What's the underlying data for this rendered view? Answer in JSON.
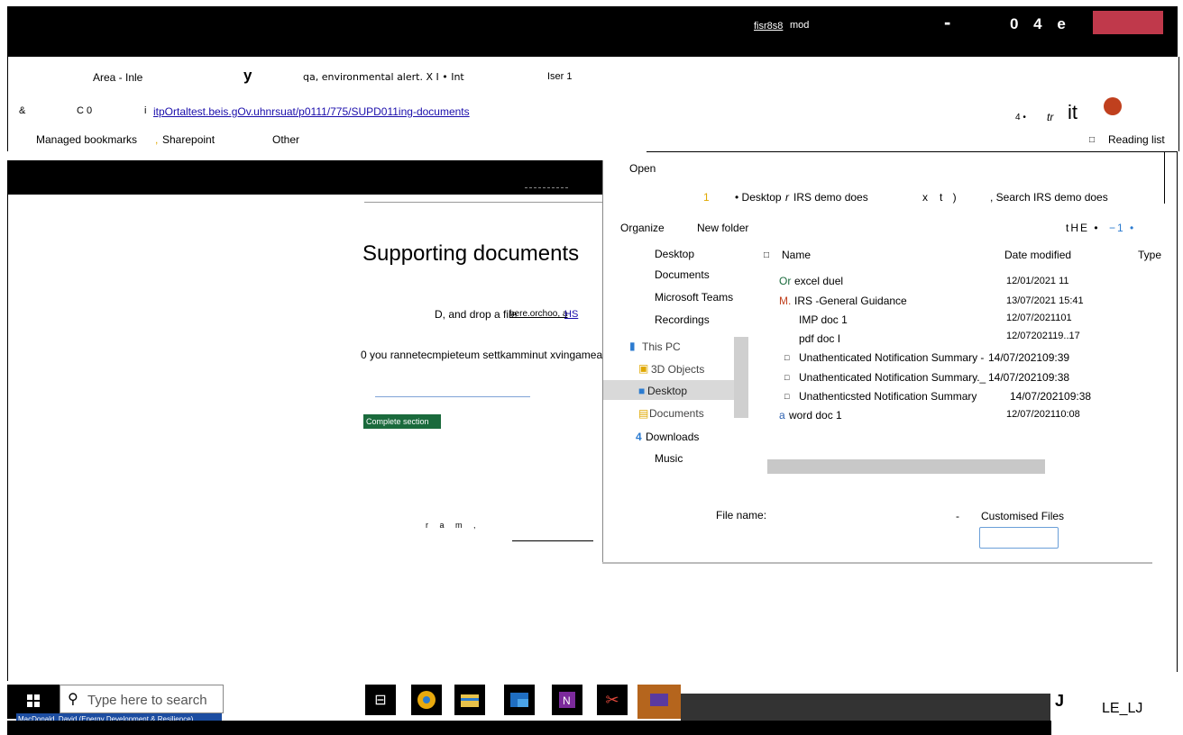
{
  "browser": {
    "top_link": "fisr8s8",
    "top_text": "mod",
    "top_right_a": "-",
    "top_right_b": "0 4 e",
    "tab_area": "Area - Inle",
    "tab_y": "y",
    "tab_alert": "qa, environmental alert. X I • Int",
    "tab_user": "Iser 1",
    "addr_amp": "&",
    "addr_c": "C 0",
    "addr_i": "i",
    "url": "itpOrtaltest.beis.gOv.uhnrsuat/p0111/775/SUPD011ing-documents",
    "addr_right_small": "4 •",
    "addr_right_tr": "tr",
    "addr_right_it": "it",
    "bookmarks": [
      "Managed bookmarks",
      "Sharepoint",
      "Other"
    ],
    "bookmark_sep": ",",
    "reading_list": "Reading list"
  },
  "page": {
    "heading": "Supporting documents",
    "drop_text": "D, and drop a file",
    "drop_link": "here.orchoo, a",
    "drop_link2": "HS",
    "info_text": "0 you rannetecmpieteum settkamminut xvingamea",
    "complete_button": "Complete section",
    "bottom_text": "r a m ,"
  },
  "dialog": {
    "title": "Open",
    "nav_num": "1",
    "breadcrumb": "• Desktop",
    "breadcrumb_r": "r",
    "breadcrumb_folder": "IRS demo does",
    "breadcrumb_x": "x",
    "breadcrumb_t": "t )",
    "search_placeholder": ", Search IRS demo does",
    "organize": "Organize",
    "new_folder": "New folder",
    "view_a": "tHE •",
    "view_b": "−1 •",
    "quick_access": [
      "Desktop",
      "Documents",
      "Microsoft Teams",
      "Recordings"
    ],
    "this_pc": "This PC",
    "pc_items": [
      "3D Objects",
      "Desktop",
      "Documents"
    ],
    "downloads_prefix": "4",
    "downloads": "Downloads",
    "music": "Music",
    "col_name": "Name",
    "col_date": "Date modified",
    "col_type": "Type",
    "files": [
      {
        "prefix": "Or",
        "name": "excel duel",
        "date": "12/01/2021 11"
      },
      {
        "prefix": "M.",
        "name": "IRS -General Guidance",
        "date": "13/07/2021 15:41"
      },
      {
        "prefix": "",
        "name": "IMP doc 1",
        "date": "12/07/2021101"
      },
      {
        "prefix": "",
        "name": "pdf doc I",
        "date": "12/07202119..17"
      },
      {
        "prefix": "□",
        "name": "Unathenticated Notification Summary -",
        "date": "14/07/202109:39"
      },
      {
        "prefix": "□",
        "name": "Unathenticated Notification Summary._",
        "date": "14/07/202109:38"
      },
      {
        "prefix": "□",
        "name": "Unathenticsted Notification Summary",
        "date": "14/07/202109:38"
      },
      {
        "prefix": "a",
        "name": "word doc 1",
        "date": "12/07/202110:08"
      }
    ],
    "file_name_label": "File name:",
    "dash": "-",
    "filter": "Customised Files"
  },
  "taskbar": {
    "search_placeholder": "Type here to search",
    "user": "MacDonald, David (Energy Development & Resilience)",
    "right_a": "J",
    "right_b": "LE_LJ"
  },
  "colors": {
    "complete_green": "#1a6a3c",
    "red_block": "#c0394b",
    "orange_dot": "#c0401e"
  }
}
